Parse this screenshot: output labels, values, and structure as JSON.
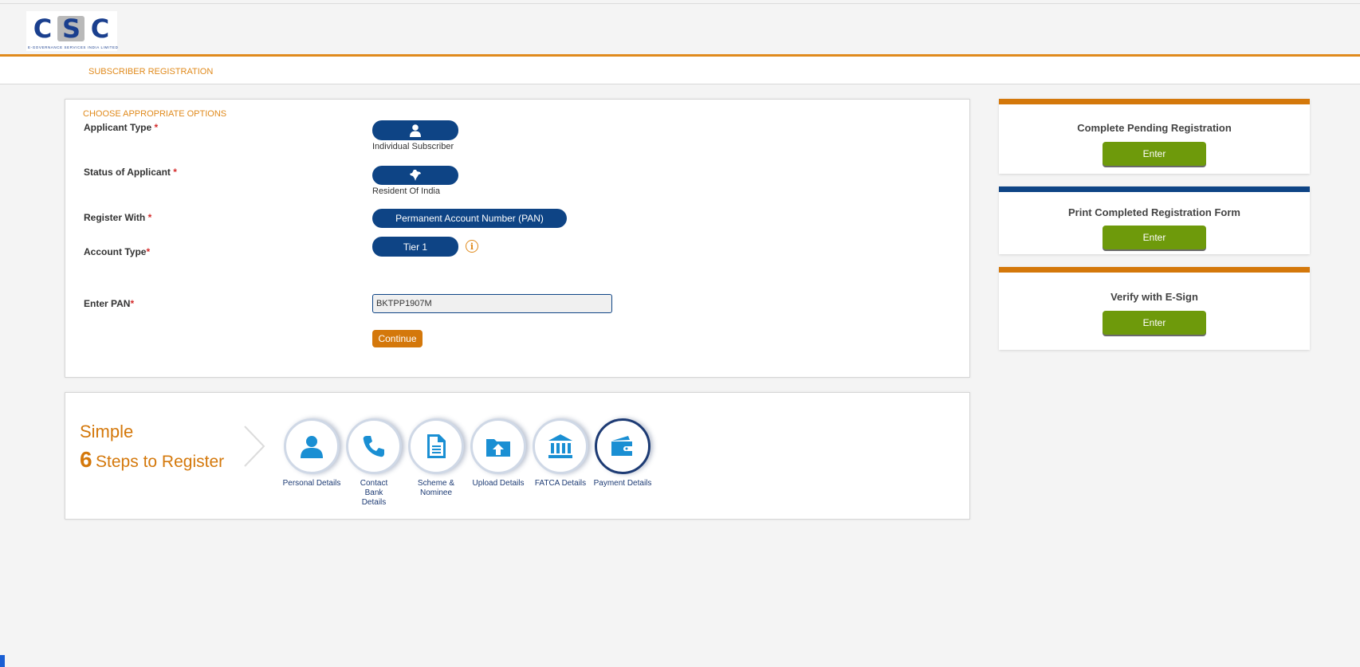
{
  "brand": {
    "logo_letters": [
      "C",
      "S",
      "C"
    ],
    "logo_tagline": "E-GOVERNANCE SERVICES INDIA LIMITED",
    "colors": {
      "orange": "#d4780b",
      "navy": "#0e4485",
      "green": "#6e9a0b"
    }
  },
  "header": {
    "title": "SUBSCRIBER REGISTRATION"
  },
  "form": {
    "section_title": "CHOOSE APPROPRIATE OPTIONS",
    "required_mark": "*",
    "applicant_type": {
      "label": "Applicant Type",
      "icon": "user-icon",
      "caption": "Individual Subscriber"
    },
    "status": {
      "label": "Status of Applicant",
      "icon": "india-map-icon",
      "caption": "Resident Of India"
    },
    "register_with": {
      "label": "Register With",
      "value": "Permanent Account Number (PAN)"
    },
    "account_type": {
      "label": "Account Type",
      "value": "Tier 1",
      "info_icon": "i"
    },
    "pan": {
      "label": "Enter PAN",
      "value": "BKTPP1907M"
    },
    "continue_label": "Continue"
  },
  "steps": {
    "simple": "Simple",
    "count": "6",
    "tail": "Steps to Register",
    "items": [
      {
        "icon": "person-icon",
        "label": "Personal Details"
      },
      {
        "icon": "phone-icon",
        "label": "Contact Bank Details"
      },
      {
        "icon": "document-icon",
        "label": "Scheme & Nominee"
      },
      {
        "icon": "upload-icon",
        "label": "Upload Details"
      },
      {
        "icon": "bank-icon",
        "label": "FATCA Details"
      },
      {
        "icon": "wallet-icon",
        "label": "Payment Details"
      }
    ]
  },
  "side": {
    "pending": {
      "title": "Complete Pending Registration",
      "button": "Enter"
    },
    "print": {
      "title": "Print Completed Registration Form",
      "button": "Enter"
    },
    "esign": {
      "title": "Verify with E-Sign",
      "button": "Enter"
    }
  }
}
